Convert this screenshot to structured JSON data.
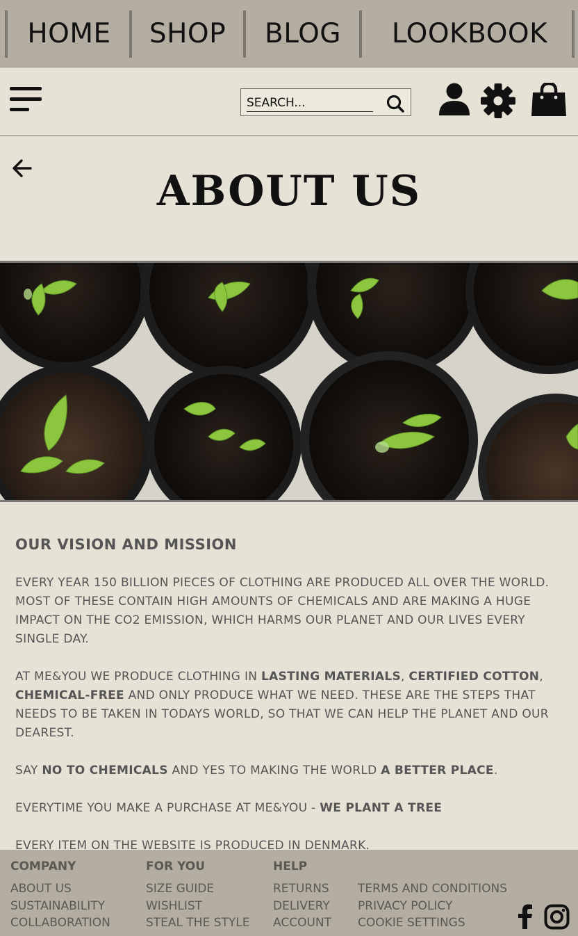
{
  "topnav": {
    "items": [
      {
        "label": "HOME"
      },
      {
        "label": "SHOP"
      },
      {
        "label": "BLOG"
      },
      {
        "label": "LOOKBOOK"
      }
    ]
  },
  "header": {
    "search_placeholder": "SEARCH...",
    "icons": [
      "menu-icon",
      "search-icon",
      "user-icon",
      "gear-icon",
      "shopping-bag-icon"
    ]
  },
  "page": {
    "title": "ABOUT US",
    "back_icon": "arrow-left-icon"
  },
  "hero": {
    "image": "seedlings in black plant pots, top view"
  },
  "content": {
    "heading": "OUR VISION AND MISSION",
    "p1": "EVERY YEAR 150 BILLION PIECES OF CLOTHING ARE PRODUCED ALL OVER THE WORLD. MOST OF THESE CONTAIN HIGH AMOUNTS OF CHEMICALS AND ARE MAKING A HUGE IMPACT ON THE CO2 EMISSION, WHICH HARMS OUR PLANET AND OUR LIVES EVERY SINGLE DAY.",
    "p2_a": "AT ME&YOU WE PRODUCE CLOTHING IN ",
    "p2_b": "LASTING MATERIALS",
    "p2_c": ", ",
    "p2_d": "CERTIFIED COTTON",
    "p2_e": ", ",
    "p2_f": "CHEMICAL-FREE",
    "p2_g": " AND ONLY PRODUCE WHAT WE NEED. THESE ARE THE STEPS THAT NEEDS TO BE TAKEN IN TODAYS WORLD, SO THAT WE CAN HELP THE PLANET AND OUR DEAREST.",
    "p3_a": "SAY ",
    "p3_b": "NO TO CHEMICALS",
    "p3_c": " AND YES TO MAKING THE WORLD ",
    "p3_d": "A BETTER PLACE",
    "p3_e": ".",
    "p4_a": "EVERYTIME YOU MAKE A PURCHASE AT ME&YOU - ",
    "p4_b": "WE PLANT A TREE",
    "p5": "EVERY ITEM ON THE WEBSITE IS PRODUCED IN DENMARK."
  },
  "footer": {
    "company": {
      "heading": "COMPANY",
      "links": [
        "ABOUT US",
        "SUSTAINABILITY",
        "COLLABORATION"
      ]
    },
    "for_you": {
      "heading": "FOR YOU",
      "links": [
        "SIZE GUIDE",
        "WISHLIST",
        "STEAL THE STYLE"
      ]
    },
    "help": {
      "heading": "HELP",
      "links": [
        "RETURNS",
        "DELIVERY",
        "ACCOUNT"
      ]
    },
    "legal": {
      "links": [
        "TERMS AND CONDITIONS",
        "PRIVACY POLICY",
        "COOKIE SETTINGS"
      ]
    },
    "social": [
      "facebook-icon",
      "instagram-icon"
    ]
  },
  "colors": {
    "nav_bg": "#b4aea2",
    "page_bg": "#e6e3d6",
    "text_muted": "#555555"
  }
}
